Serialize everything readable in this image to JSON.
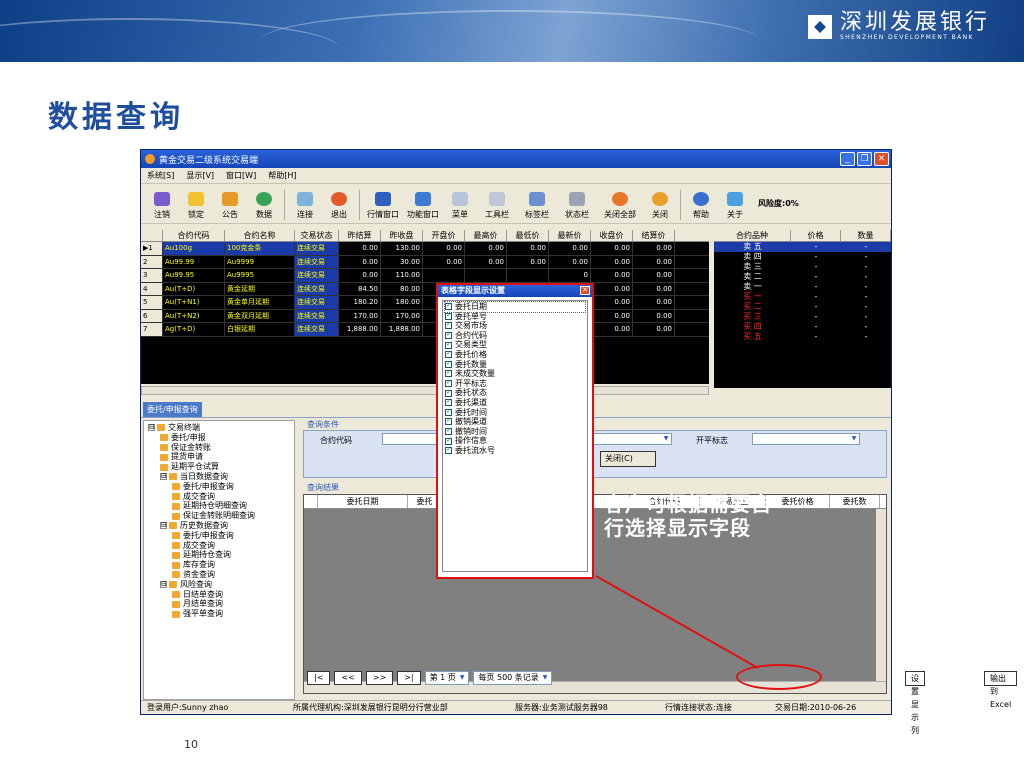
{
  "slide": {
    "title": "数据查询",
    "page_number": "10"
  },
  "logo": {
    "cn": "深圳发展银行",
    "en": "SHENZHEN DEVELOPMENT BANK"
  },
  "window": {
    "title": "黄金交易二级系统交易端",
    "menu": [
      "系统[S]",
      "显示[V]",
      "窗口[W]",
      "帮助[H]"
    ],
    "toolbar": [
      "注销",
      "锁定",
      "公告",
      "数据",
      "连接",
      "退出",
      "行情窗口",
      "功能窗口",
      "菜单",
      "工具栏",
      "标签栏",
      "状态栏",
      "关闭全部",
      "关闭",
      "帮助",
      "关于"
    ],
    "risk_label": "风险度:0%"
  },
  "quotes": {
    "headers": [
      "",
      "合约代码",
      "合约名称",
      "交易状态",
      "昨结算",
      "昨收盘",
      "开盘价",
      "最高价",
      "最低价",
      "最新价",
      "收盘价",
      "结算价"
    ],
    "rows": [
      [
        "▶1",
        "Au100g",
        "100克金条",
        "连续交易",
        "0.00",
        "130.00",
        "0.00",
        "0.00",
        "0.00",
        "0.00",
        "0.00",
        "0.00"
      ],
      [
        "2",
        "Au99.99",
        "Au9999",
        "连续交易",
        "0.00",
        "30.00",
        "0.00",
        "0.00",
        "0.00",
        "0.00",
        "0.00",
        "0.00"
      ],
      [
        "3",
        "Au99.95",
        "Au9995",
        "连续交易",
        "0.00",
        "110.00",
        "",
        "",
        "",
        "0",
        "0.00",
        "0.00"
      ],
      [
        "4",
        "Au(T+D)",
        "黄金延期",
        "连续交易",
        "84.50",
        "80.00",
        "",
        "",
        "",
        "0",
        "0.00",
        "0.00"
      ],
      [
        "5",
        "Au(T+N1)",
        "黄金单月延期",
        "连续交易",
        "180.20",
        "180.00",
        "",
        "",
        "",
        "0",
        "0.00",
        "0.00"
      ],
      [
        "6",
        "Au(T+N2)",
        "黄金双月延期",
        "连续交易",
        "170.00",
        "170.00",
        "",
        "",
        "",
        "0",
        "0.00",
        "0.00"
      ],
      [
        "7",
        "Ag(T+D)",
        "白银延期",
        "连续交易",
        "1,888.00",
        "1,888.00",
        "",
        "",
        "",
        "0",
        "0.00",
        "0.00"
      ]
    ]
  },
  "depth": {
    "headers": [
      "合约品种",
      "价格",
      "数量"
    ],
    "sell": [
      "卖 五",
      "卖 四",
      "卖 三",
      "卖 二",
      "卖 一"
    ],
    "buy": [
      "买 一",
      "买 二",
      "买 三",
      "买 四",
      "买 五"
    ],
    "dash": "-"
  },
  "tab_label": "委托/申报查询",
  "tree": [
    {
      "label": "交易终端",
      "level": 0,
      "expand": "⊟"
    },
    {
      "label": "委托/申报",
      "level": 1
    },
    {
      "label": "保证金转账",
      "level": 1
    },
    {
      "label": "提货申请",
      "level": 1
    },
    {
      "label": "延期平仓试算",
      "level": 1
    },
    {
      "label": "当日数据查询",
      "level": 1,
      "expand": "⊟"
    },
    {
      "label": "委托/申报查询",
      "level": 2
    },
    {
      "label": "成交查询",
      "level": 2
    },
    {
      "label": "延期持仓明细查询",
      "level": 2
    },
    {
      "label": "保证金转账明细查询",
      "level": 2
    },
    {
      "label": "历史数据查询",
      "level": 1,
      "expand": "⊟"
    },
    {
      "label": "委托/申报查询",
      "level": 2
    },
    {
      "label": "成交查询",
      "level": 2
    },
    {
      "label": "延期持仓查询",
      "level": 2
    },
    {
      "label": "库存查询",
      "level": 2
    },
    {
      "label": "资金查询",
      "level": 2
    },
    {
      "label": "风险查询",
      "level": 1,
      "expand": "⊟"
    },
    {
      "label": "日结单查询",
      "level": 2
    },
    {
      "label": "月结单查询",
      "level": 2
    },
    {
      "label": "强平单查询",
      "level": 2
    }
  ],
  "conditions": {
    "title": "查询条件",
    "contract_label": "合约代码",
    "open_close_label": "开平标志",
    "close_button": "关闭(C)"
  },
  "results": {
    "title": "查询结果",
    "headers": [
      "",
      "委托日期",
      "委托",
      "号",
      "合约代码",
      "交易类型",
      "委托价格",
      "委托数"
    ]
  },
  "pager": {
    "first": "|<",
    "prev": "<<",
    "next": ">>",
    "last": ">|",
    "page": "第 1 页",
    "per_page": "每页 500  条记录",
    "set_columns": "设置显示列",
    "export": "输出到Excel"
  },
  "statusbar": {
    "user": "登录用户:Sunny zhao",
    "org": "所属代理机构:深圳发展银行昆明分行营业部",
    "server": "服务器:业务测试服务器98",
    "conn": "行情连接状态:连接",
    "date": "交易日期:2010-06-26"
  },
  "dialog": {
    "title": "表格字段显示设置",
    "fields": [
      "委托日期",
      "委托单号",
      "交易市场",
      "合约代码",
      "交易类型",
      "委托价格",
      "委托数量",
      "未成交数量",
      "开平标志",
      "委托状态",
      "委托渠道",
      "委托时间",
      "撤销渠道",
      "撤销时间",
      "操作信息",
      "委托流水号"
    ]
  },
  "annotation": "客户可根据需要自行选择显示字段",
  "colors": {
    "title_blue": "#1f4e9c",
    "highlight_red": "#e01010",
    "quote_yellow": "#ffff00",
    "sell_red": "#ff2a2a"
  }
}
